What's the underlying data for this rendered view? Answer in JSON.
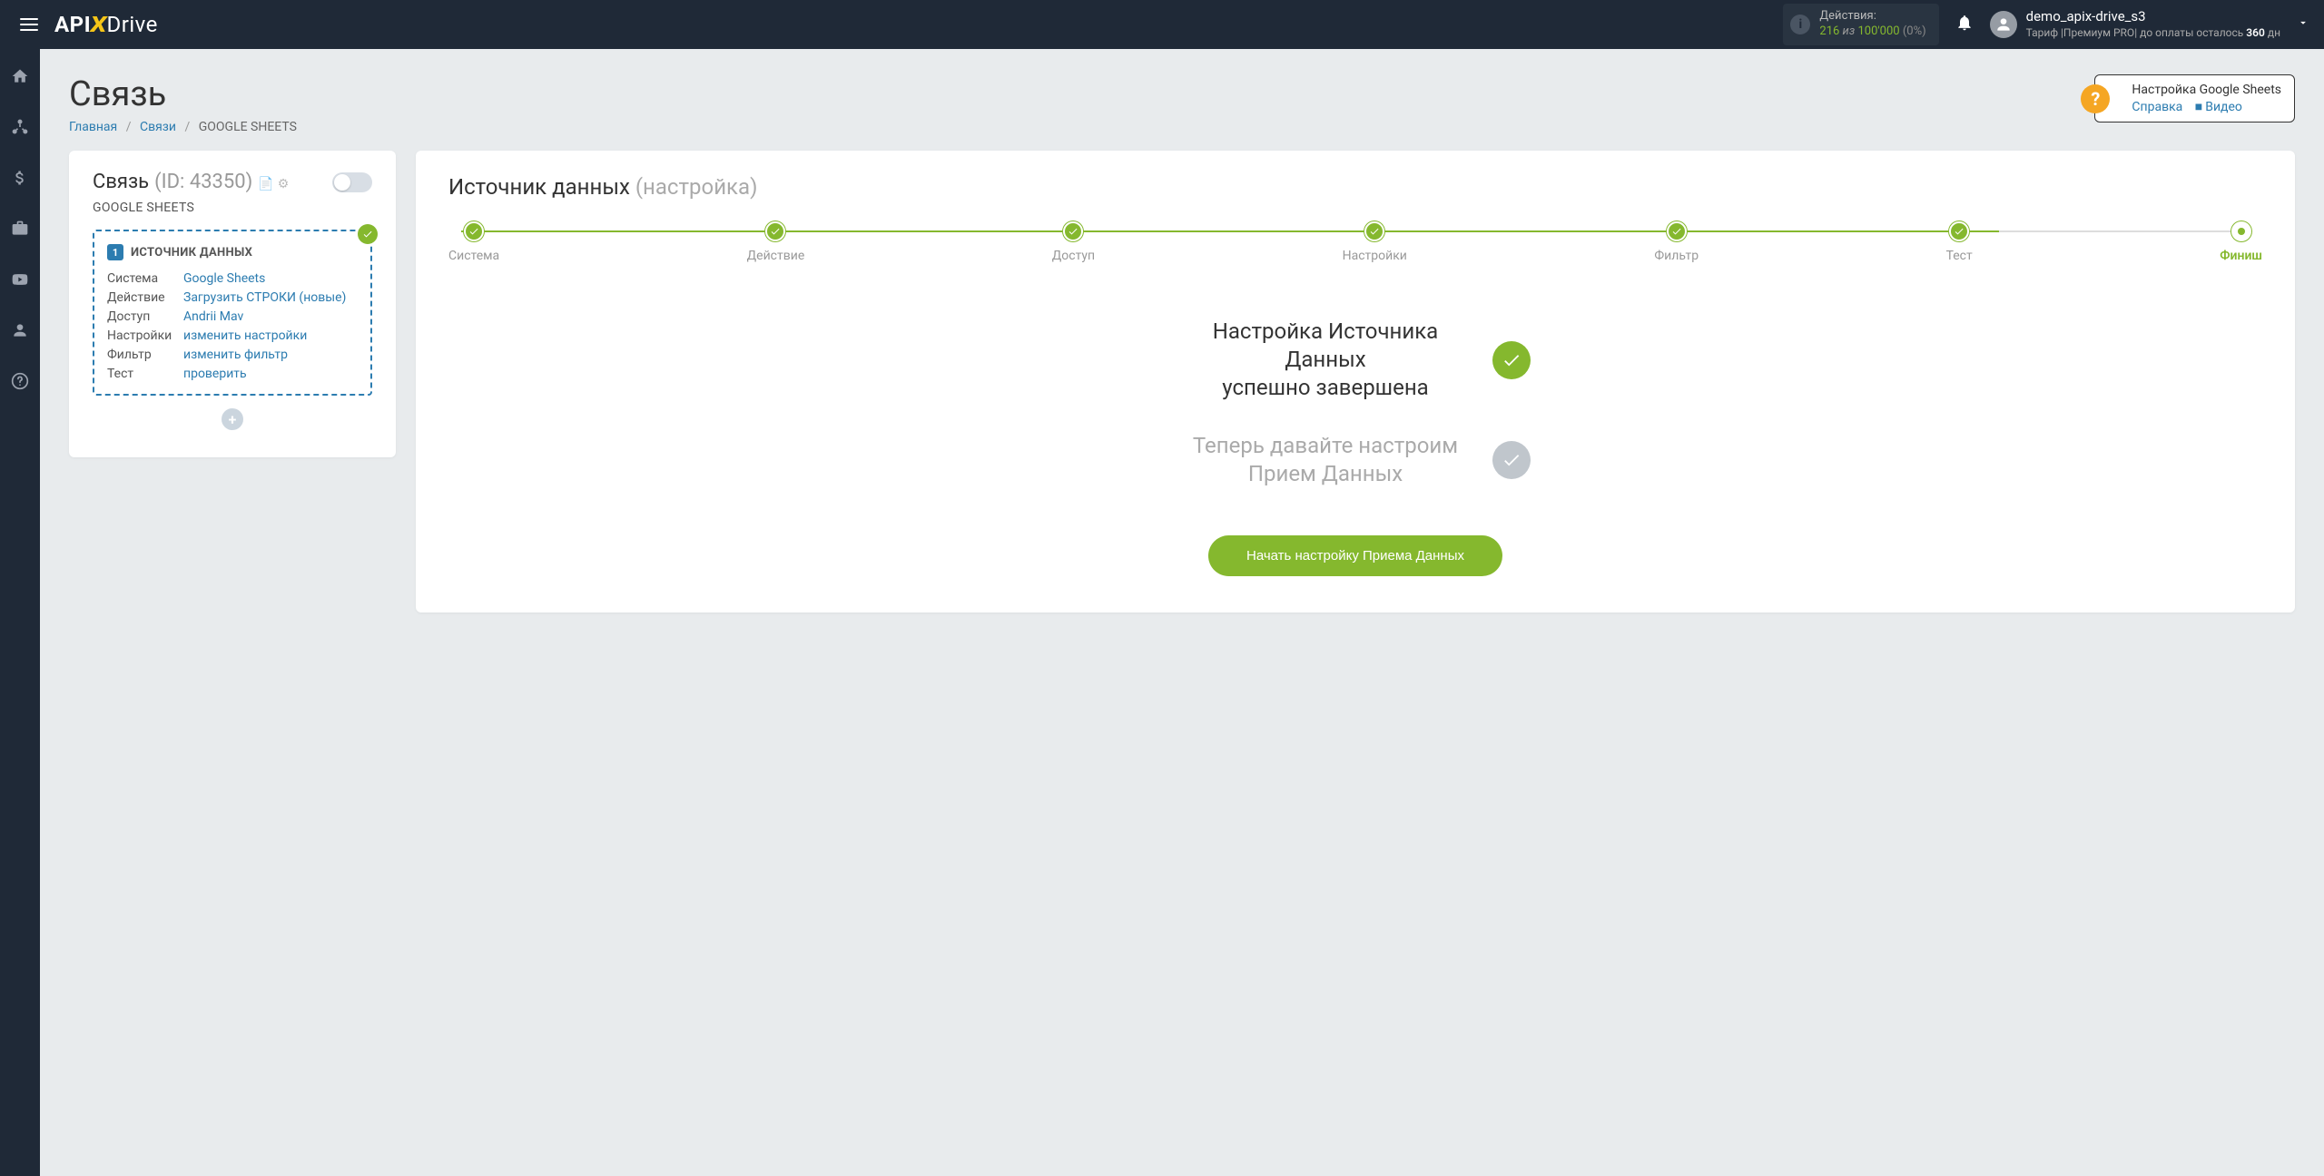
{
  "header": {
    "actions_label": "Действия:",
    "count": "216",
    "of": "из",
    "max": "100'000",
    "pct": "(0%)",
    "username": "demo_apix-drive_s3",
    "tariff_prefix": "Тариф |Премиум PRO|",
    "days_left_prefix": " до оплаты осталось ",
    "days_left": "360",
    "days_suffix": "дн"
  },
  "page": {
    "title": "Связь",
    "breadcrumb": {
      "home": "Главная",
      "links": "Связи",
      "current": "GOOGLE SHEETS"
    },
    "help": {
      "title": "Настройка Google Sheets",
      "reference": "Справка",
      "video": "Видео"
    }
  },
  "left": {
    "card_title": "Связь",
    "card_id": "(ID: 43350)",
    "connection_name": "GOOGLE SHEETS",
    "source": {
      "num": "1",
      "title": "ИСТОЧНИК ДАННЫХ",
      "rows": {
        "system_label": "Система",
        "system_value": "Google Sheets",
        "action_label": "Действие",
        "action_value": "Загрузить СТРОКИ (новые)",
        "access_label": "Доступ",
        "access_value": "Andrii Mav",
        "settings_label": "Настройки",
        "settings_value": "изменить настройки",
        "filter_label": "Фильтр",
        "filter_value": "изменить фильтр",
        "test_label": "Тест",
        "test_value": "проверить"
      }
    }
  },
  "right": {
    "title_main": "Источник данных",
    "title_sub": "(настройка)",
    "steps": {
      "s1": "Система",
      "s2": "Действие",
      "s3": "Доступ",
      "s4": "Настройки",
      "s5": "Фильтр",
      "s6": "Тест",
      "s7": "Финиш"
    },
    "done_line1": "Настройка Источника Данных",
    "done_line2": "успешно завершена",
    "pending_line1": "Теперь давайте настроим",
    "pending_line2": "Прием Данных",
    "button": "Начать настройку Приема Данных"
  }
}
